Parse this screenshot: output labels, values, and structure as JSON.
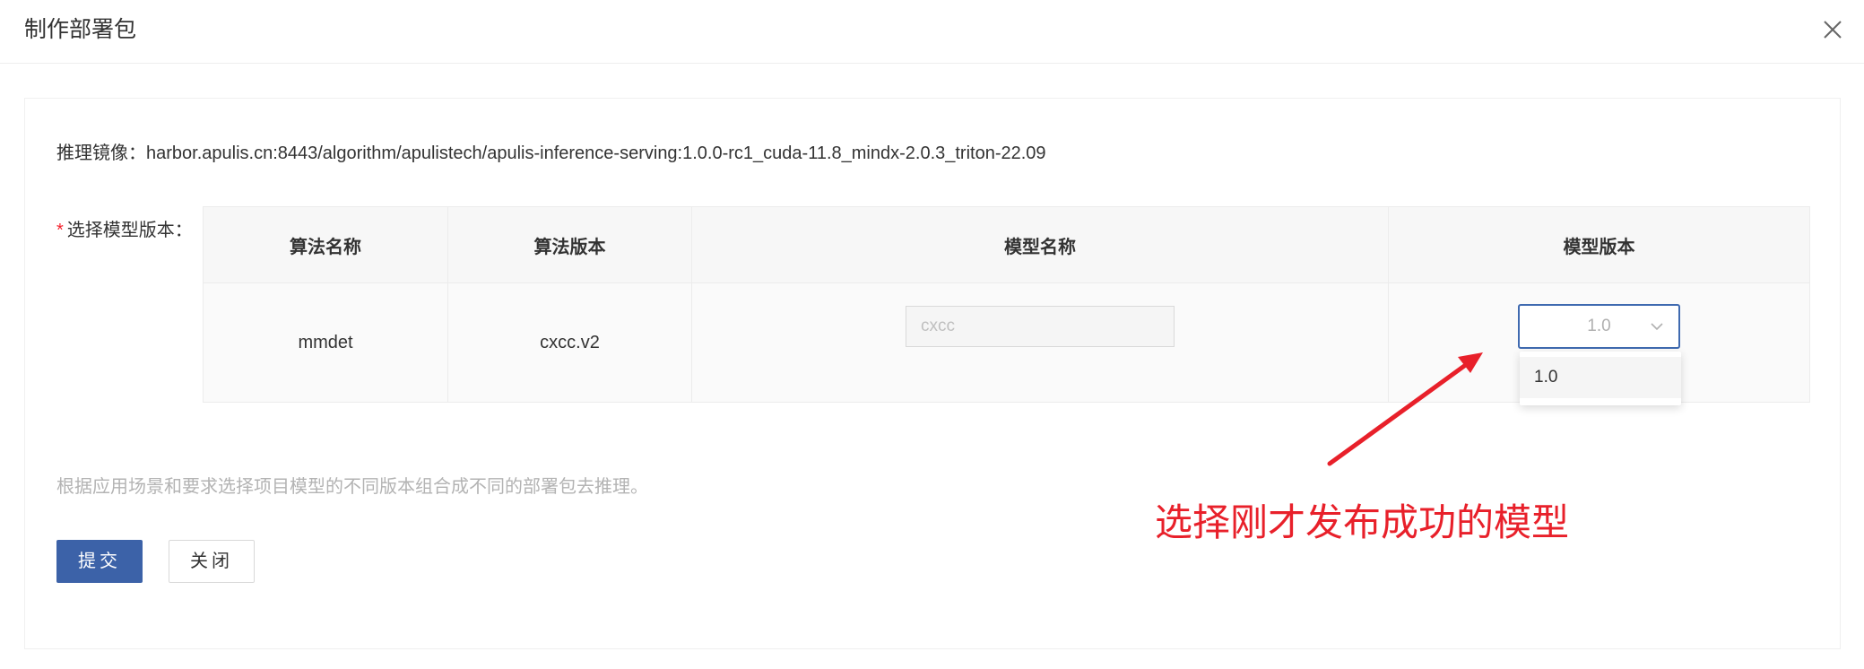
{
  "dialog": {
    "title": "制作部署包"
  },
  "image": {
    "label": "推理镜像：",
    "value": "harbor.apulis.cn:8443/algorithm/apulistech/apulis-inference-serving:1.0.0-rc1_cuda-11.8_mindx-2.0.3_triton-22.09"
  },
  "model_select": {
    "required_mark": "*",
    "label": "选择模型版本："
  },
  "table": {
    "headers": [
      "算法名称",
      "算法版本",
      "模型名称",
      "模型版本"
    ],
    "rows": [
      {
        "algorithm_name": "mmdet",
        "algorithm_version": "cxcc.v2",
        "model_name_placeholder": "cxcc",
        "model_version_selected": "1.0"
      }
    ]
  },
  "dropdown": {
    "options": [
      "1.0"
    ]
  },
  "hint": "根据应用场景和要求选择项目模型的不同版本组合成不同的部署包去推理。",
  "buttons": {
    "submit": "提交",
    "close": "关闭"
  },
  "annotation": {
    "text": "选择刚才发布成功的模型",
    "color": "#e8202a"
  },
  "colors": {
    "primary": "#3c62a8",
    "select_border": "#3f6ab0",
    "required": "#f5222d"
  },
  "icons": {
    "close": "close-icon",
    "select_arrow": "chevron-down-icon"
  }
}
